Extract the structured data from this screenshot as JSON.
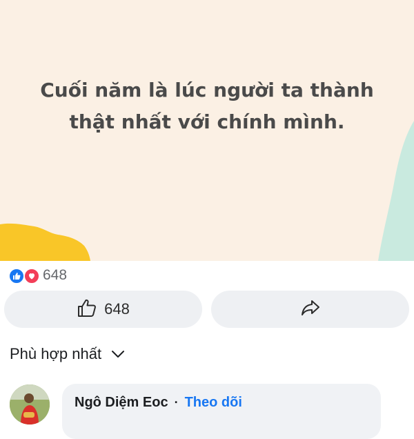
{
  "post": {
    "text_line1": "Cuối năm là lúc người ta thành",
    "text_line2": "thật nhất với chính mình.",
    "background_color": "#fbf0e4",
    "accent_yellow": "#f9c628",
    "accent_mint": "#c9eadf"
  },
  "reactions": {
    "count": "648",
    "types": [
      "like-icon",
      "love-icon"
    ]
  },
  "actions": {
    "like_count": "648",
    "like_icon": "thumbs-up-icon",
    "share_icon": "share-icon"
  },
  "sort": {
    "label": "Phù hợp nhất",
    "icon": "chevron-down-icon"
  },
  "comment": {
    "author": "Ngô Diệm Eoc",
    "separator": "·",
    "follow_label": "Theo dõi"
  },
  "colors": {
    "brand_blue": "#1877f2",
    "love_red": "#f33e58",
    "button_bg": "#eef0f3",
    "bubble_bg": "#f0f2f5"
  }
}
